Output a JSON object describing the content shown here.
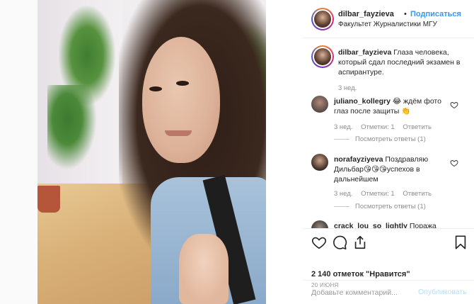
{
  "header": {
    "username": "dilbar_fayzieva",
    "separator": "•",
    "follow_label": "Подписаться",
    "subtitle": "Факультет Журналистики МГУ"
  },
  "caption": {
    "username": "dilbar_fayzieva",
    "text": "Глаза человека, который сдал последний экзамен в аспирантуре.",
    "age": "3 нед."
  },
  "comments": [
    {
      "username": "juliano_kollegry",
      "text": "😂 ждём фото глаз после защиты 👏",
      "age": "3 нед.",
      "likes_label": "Отметки: 1",
      "reply_label": "Ответить",
      "view_replies": "Посмотреть ответы (1)"
    },
    {
      "username": "norafayziyeva",
      "text": "Поздравляю Дильбар😘😘😘успехов в дальнейшем",
      "age": "3 нед.",
      "likes_label": "Отметки: 1",
      "reply_label": "Ответить",
      "view_replies": "Посмотреть ответы (1)"
    },
    {
      "username": "crack_lou_so_lightly",
      "text": "Поража",
      "age": "",
      "likes_label": "",
      "reply_label": "",
      "view_replies": ""
    }
  ],
  "actions": {
    "like_icon": "heart-icon",
    "comment_icon": "comment-icon",
    "share_icon": "share-icon",
    "save_icon": "bookmark-icon",
    "likes_text": "2 140 отметок \"Нравится\"",
    "date": "20 июня"
  },
  "add_comment": {
    "placeholder": "Добавьте комментарий...",
    "publish_label": "Опубликовать"
  },
  "colors": {
    "accent_blue": "#3897f0",
    "publish_disabled": "#b2dffc",
    "muted_text": "#8e8e8e",
    "border": "#efefef"
  }
}
